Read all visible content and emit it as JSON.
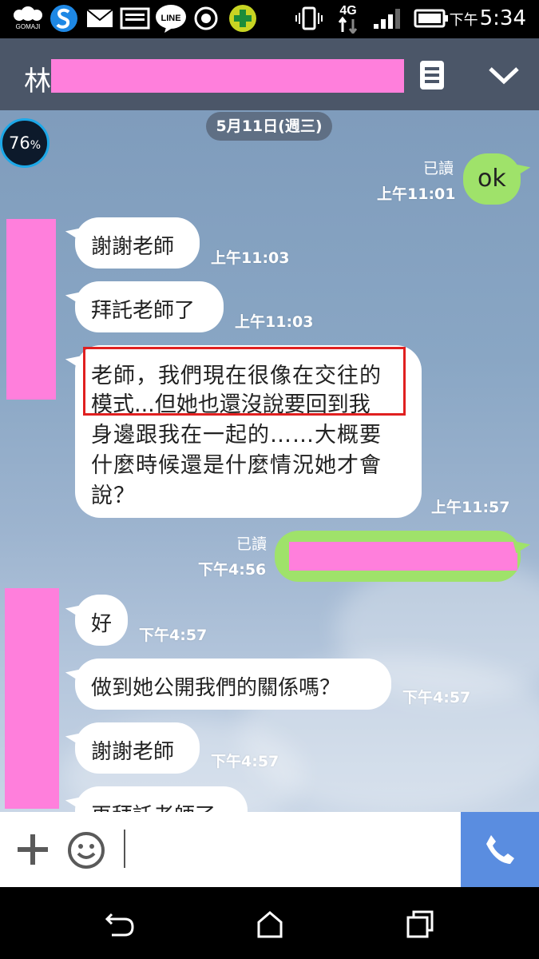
{
  "status_bar": {
    "gomaji_label": "GOMAJI",
    "line_label": "LINE",
    "network": "4G",
    "time_prefix": "下午",
    "time": "5:34",
    "icons": [
      "gomaji-icon",
      "s-app-icon",
      "mail-icon",
      "gallery-icon",
      "line-icon",
      "record-icon",
      "plus-app-icon",
      "vibrate-icon",
      "network-4g-icon",
      "signal-icon",
      "battery-icon"
    ]
  },
  "header": {
    "title_visible": "林",
    "icons": [
      "memo-icon",
      "chevron-down-icon"
    ]
  },
  "chat": {
    "date_label": "5月11日(週三)",
    "battery_widget": {
      "value": "76",
      "unit": "%"
    },
    "messages": [
      {
        "side": "right",
        "text": "ok",
        "read": "已讀",
        "time": "上午11:01"
      },
      {
        "side": "left",
        "text": "謝謝老師",
        "time": "上午11:03"
      },
      {
        "side": "left",
        "text": "拜託老師了",
        "time": "上午11:03"
      },
      {
        "side": "left",
        "lines": [
          "老師，我們現在很像在交往的",
          "模式...但她也還沒說要回到我",
          "身邊跟我在一起的……大概要",
          "什麼時候還是什麼情況她才會",
          "說？"
        ],
        "time": "上午11:57"
      },
      {
        "side": "right",
        "text": "",
        "read": "已讀",
        "time": "下午4:56",
        "redacted": true
      },
      {
        "side": "left",
        "text": "好",
        "time": "下午4:57"
      },
      {
        "side": "left",
        "text": "做到她公開我們的關係嗎？",
        "time": "下午4:57"
      },
      {
        "side": "left",
        "text": "謝謝老師",
        "time": "下午4:57"
      },
      {
        "side": "left",
        "text": "再拜託老師了",
        "time": ""
      }
    ]
  },
  "input_bar": {
    "icons": [
      "plus-icon",
      "emoji-icon",
      "phone-call-icon"
    ]
  },
  "nav_bar": {
    "icons": [
      "back-icon",
      "home-icon",
      "recents-icon"
    ]
  },
  "colors": {
    "header_bg": "#4b5668",
    "green_bubble": "#9fe26a",
    "redaction": "#ff7fdc",
    "call_button": "#5a8de0",
    "highlight_box": "#e02020"
  }
}
